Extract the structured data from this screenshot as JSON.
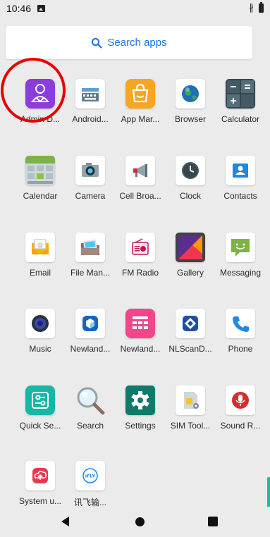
{
  "status_bar": {
    "time": "10:46"
  },
  "search": {
    "label": "Search apps",
    "icon": "search-icon"
  },
  "apps": [
    {
      "label": "Admin D...",
      "icon": "admin-icon"
    },
    {
      "label": "Android...",
      "icon": "keyboard-icon"
    },
    {
      "label": "App Mar...",
      "icon": "shopping-bag-icon"
    },
    {
      "label": "Browser",
      "icon": "globe-icon"
    },
    {
      "label": "Calculator",
      "icon": "calculator-icon"
    },
    {
      "label": "Calendar",
      "icon": "calendar-icon"
    },
    {
      "label": "Camera",
      "icon": "camera-icon"
    },
    {
      "label": "Cell Broa...",
      "icon": "megaphone-icon"
    },
    {
      "label": "Clock",
      "icon": "clock-icon"
    },
    {
      "label": "Contacts",
      "icon": "contact-card-icon"
    },
    {
      "label": "Email",
      "icon": "envelope-icon"
    },
    {
      "label": "File Man...",
      "icon": "folder-icon"
    },
    {
      "label": "FM Radio",
      "icon": "radio-icon"
    },
    {
      "label": "Gallery",
      "icon": "picture-icon"
    },
    {
      "label": "Messaging",
      "icon": "chat-bubble-icon"
    },
    {
      "label": "Music",
      "icon": "speaker-icon"
    },
    {
      "label": "Newland...",
      "icon": "newland-cube-icon"
    },
    {
      "label": "Newland...",
      "icon": "newland-keypad-icon"
    },
    {
      "label": "NLScanD...",
      "icon": "nlscan-icon"
    },
    {
      "label": "Phone",
      "icon": "phone-icon"
    },
    {
      "label": "Quick Se...",
      "icon": "sliders-icon"
    },
    {
      "label": "Search",
      "icon": "magnifier-icon"
    },
    {
      "label": "Settings",
      "icon": "gear-icon"
    },
    {
      "label": "SIM Tool...",
      "icon": "sim-card-icon"
    },
    {
      "label": "Sound R...",
      "icon": "microphone-icon"
    },
    {
      "label": "System u...",
      "icon": "cloud-upload-icon"
    },
    {
      "label": "讯飞输...",
      "icon": "ifly-icon"
    }
  ],
  "nav": {
    "back": "back-icon",
    "home": "home-icon",
    "recents": "recents-icon"
  },
  "colors": {
    "accent": "#1a73e8",
    "annotation": "#e60000",
    "background": "#ebebeb"
  }
}
